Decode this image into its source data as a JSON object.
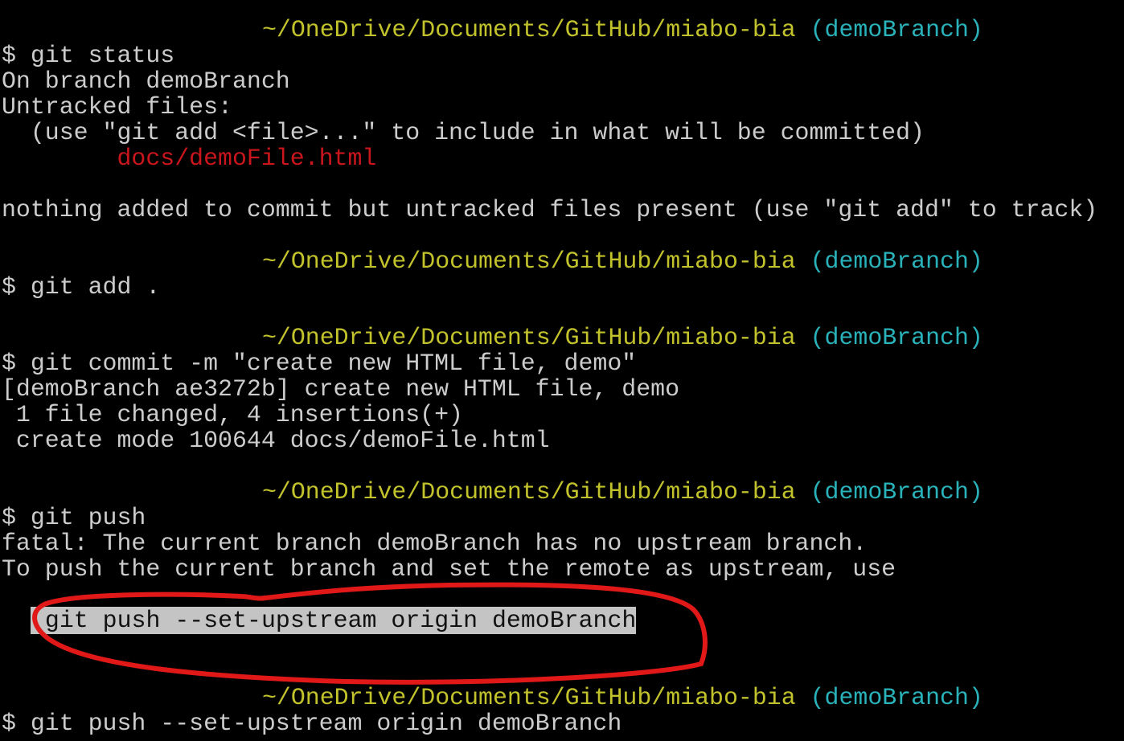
{
  "colors": {
    "background": "#000000",
    "text": "#cccccc",
    "path": "#c2c22c",
    "branch": "#2ab2ba",
    "untracked": "#c8161c",
    "annotation": "#e01818"
  },
  "prompt": {
    "path": "~/OneDrive/Documents/GitHub/miabo-bia",
    "branch": "(demoBranch)"
  },
  "lines": {
    "cmd_status": "$ git status",
    "on_branch": "On branch demoBranch",
    "untracked": "Untracked files:",
    "use_hint": "  (use \"git add <file>...\" to include in what will be committed)",
    "untracked_file": "        docs/demoFile.html",
    "nothing_added": "nothing added to commit but untracked files present (use \"git add\" to track)",
    "cmd_add": "$ git add .",
    "cmd_commit": "$ git commit -m \"create new HTML file, demo\"",
    "commit_result": "[demoBranch ae3272b] create new HTML file, demo",
    "commit_stats": " 1 file changed, 4 insertions(+)",
    "commit_mode": " create mode 100644 docs/demoFile.html",
    "cmd_push": "$ git push",
    "fatal": "fatal: The current branch demoBranch has no upstream branch.",
    "to_push": "To push the current branch and set the remote as upstream, use",
    "suggested": " git push --set-upstream origin demoBranch",
    "cmd_push_upstream": "$ git push --set-upstream origin demoBranch"
  }
}
